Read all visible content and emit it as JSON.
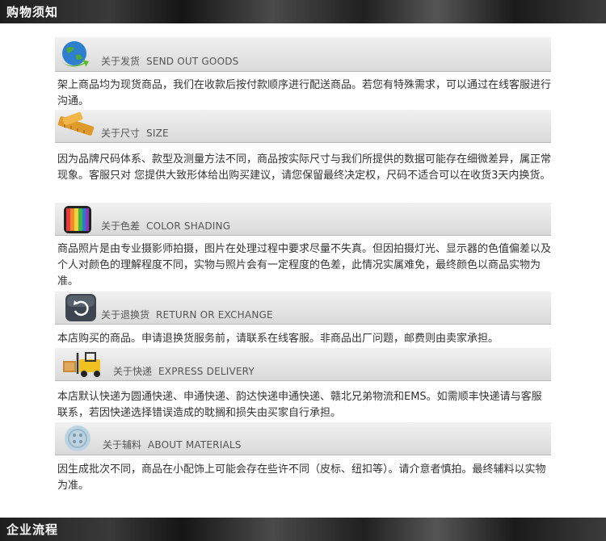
{
  "header": {
    "title": "购物须知"
  },
  "sections": [
    {
      "title_cn": "关于发货",
      "title_en": "SEND OUT   GOODS",
      "icon": "globe-arrow-icon",
      "text": "架上商品均为现货商品，我们在收款后按付款顺序进行配送商品。若您有特殊需求，可以通过在线客服进行沟通。"
    },
    {
      "title_cn": "关于尺寸",
      "title_en": "SIZE",
      "icon": "ruler-icon",
      "text": "因为品牌尺码体系、款型及测量方法不同，商品按实际尺寸与我们所提供的数据可能存在细微差异，属正常现象。客服只对 您提供大致形体给出购买建议，请您保留最终决定权，尺码不适合可以在收货3天内换货。"
    },
    {
      "title_cn": "关于色差",
      "title_en": "COLOR SHADING",
      "icon": "color-swatch-icon",
      "text": "商品照片是由专业摄影师拍摄，图片在处理过程中要求尽量不失真。但因拍摄灯光、显示器的色值偏差以及个人对颜色的理解程度不同，实物与照片会有一定程度的色差，此情况实属难免，最终颜色以商品实物为准。"
    },
    {
      "title_cn": "关于退换货",
      "title_en": "RETURN OR EXCHANGE",
      "icon": "return-icon",
      "text": "本店购买的商品。申请退换货服务前，请联系在线客服。非商品出厂问题，邮费则由卖家承担。"
    },
    {
      "title_cn": "关于快递",
      "title_en": "EXPRESS DELIVERY",
      "icon": "forklift-icon",
      "text": "本店默认快递为圆通快递、申通快递、韵达快递申通快递、赣北兄弟物流和EMS。如需顺丰快递请与客服联系，若因快递选择错误造成的耽搁和损失由买家自行承担。"
    },
    {
      "title_cn": "关于辅料",
      "title_en": "ABOUT MATERIALS",
      "icon": "button-icon",
      "text": "因生成批次不同，商品在小配饰上可能会存在些许不同（皮标、纽扣等）。请介意者慎拍。最终辅料以实物为准。"
    }
  ],
  "footer": {
    "title": "企业流程"
  }
}
